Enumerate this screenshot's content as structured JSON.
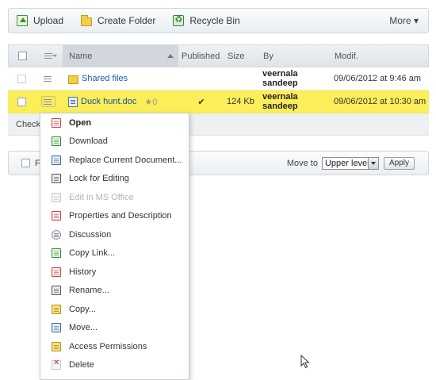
{
  "toolbar": {
    "upload_label": "Upload",
    "create_folder_label": "Create Folder",
    "recycle_bin_label": "Recycle Bin",
    "more_label": "More ▾"
  },
  "table": {
    "headers": {
      "name": "Name",
      "published": "Published",
      "size": "Size",
      "by": "By",
      "modified": "Modif."
    },
    "rows": [
      {
        "name": "Shared files",
        "type": "folder",
        "published": "",
        "size": "",
        "by": "veernala sandeep",
        "modified": "09/06/2012 at 9:46 am",
        "selected": false
      },
      {
        "name": "Duck hunt.doc",
        "type": "doc",
        "rating": "★0",
        "published": "✔",
        "size": "124 Kb",
        "by": "veernala sandeep",
        "modified": "09/06/2012 at 10:30 am",
        "selected": true
      }
    ],
    "checkbar_label": "Check"
  },
  "footer": {
    "checkbox_label": "F",
    "move_to_label": "Move to",
    "move_to_value": "Upper level",
    "apply_label": "Apply"
  },
  "context_menu": {
    "items": [
      {
        "label": "Open",
        "icon": "open-icon",
        "bold": true,
        "disabled": false
      },
      {
        "label": "Download",
        "icon": "download-icon",
        "bold": false,
        "disabled": false
      },
      {
        "label": "Replace Current Document...",
        "icon": "replace-document-icon",
        "bold": false,
        "disabled": false
      },
      {
        "label": "Lock for Editing",
        "icon": "lock-icon",
        "bold": false,
        "disabled": false
      },
      {
        "label": "Edit in MS Office",
        "icon": "ms-office-icon",
        "bold": false,
        "disabled": true
      },
      {
        "label": "Properties and Description",
        "icon": "properties-icon",
        "bold": false,
        "disabled": false
      },
      {
        "label": "Discussion",
        "icon": "discussion-icon",
        "bold": false,
        "disabled": false
      },
      {
        "label": "Copy Link...",
        "icon": "copy-link-icon",
        "bold": false,
        "disabled": false
      },
      {
        "label": "History",
        "icon": "history-icon",
        "bold": false,
        "disabled": false
      },
      {
        "label": "Rename...",
        "icon": "rename-icon",
        "bold": false,
        "disabled": false
      },
      {
        "label": "Copy...",
        "icon": "copy-icon",
        "bold": false,
        "disabled": false
      },
      {
        "label": "Move...",
        "icon": "move-icon",
        "bold": false,
        "disabled": false
      },
      {
        "label": "Access Permissions",
        "icon": "access-permissions-icon",
        "bold": false,
        "disabled": false
      },
      {
        "label": "Delete",
        "icon": "delete-icon",
        "bold": false,
        "disabled": false
      }
    ]
  },
  "colors": {
    "selected_row": "#fbee59",
    "link": "#1a5cad",
    "toolbar_border": "#cfd6dc"
  }
}
